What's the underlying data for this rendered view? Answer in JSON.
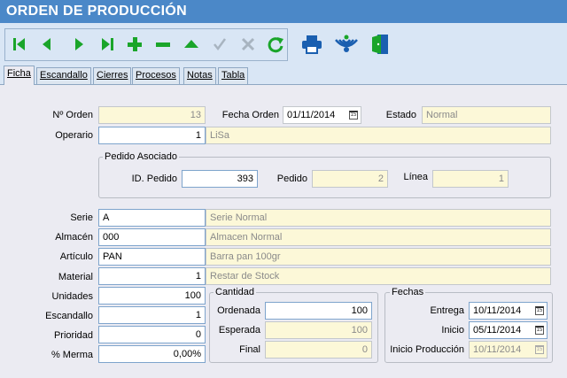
{
  "title": "ORDEN DE PRODUCCIÓN",
  "toolbar": {
    "icons": [
      "first-record-icon",
      "previous-record-icon",
      "next-record-icon",
      "last-record-icon",
      "add-icon",
      "delete-icon",
      "up-icon",
      "accept-icon",
      "cancel-icon",
      "refresh-icon",
      "print-icon",
      "wireless-icon",
      "exit-door-icon"
    ],
    "colors": {
      "green": "#1aa52a",
      "blue": "#1a5fb0",
      "disabled": "#a8b4c0"
    }
  },
  "tabs": [
    "Ficha",
    "Escandallo",
    "Cierres",
    "Procesos",
    "Notas",
    "Tabla"
  ],
  "form": {
    "num_orden_label": "Nº Orden",
    "num_orden": "13",
    "fecha_orden_label": "Fecha Orden",
    "fecha_orden": "01/11/2014",
    "estado_label": "Estado",
    "estado": "Normal",
    "operario_label": "Operario",
    "operario": "1",
    "operario_name": "LiSa"
  },
  "pedido": {
    "group_label": "Pedido Asociado",
    "id_label": "ID. Pedido",
    "id": "393",
    "pedido_label": "Pedido",
    "pedido": "2",
    "linea_label": "Línea",
    "linea": "1"
  },
  "detail": {
    "serie_label": "Serie",
    "serie": "A",
    "serie_desc": "Serie Normal",
    "almacen_label": "Almacén",
    "almacen": "000",
    "almacen_desc": "Almacen Normal",
    "articulo_label": "Artículo",
    "articulo": "PAN",
    "articulo_desc": "Barra pan 100gr",
    "material_label": "Material",
    "material": "1",
    "material_desc": "Restar de Stock",
    "unidades_label": "Unidades",
    "unidades": "100",
    "escandallo_label": "Escandallo",
    "escandallo": "1",
    "prioridad_label": "Prioridad",
    "prioridad": "0",
    "merma_label": "% Merma",
    "merma": "0,00%"
  },
  "cantidad": {
    "group_label": "Cantidad",
    "ordenada_label": "Ordenada",
    "ordenada": "100",
    "esperada_label": "Esperada",
    "esperada": "100",
    "final_label": "Final",
    "final": "0"
  },
  "fechas": {
    "group_label": "Fechas",
    "entrega_label": "Entrega",
    "entrega": "10/11/2014",
    "inicio_label": "Inicio",
    "inicio": "05/11/2014",
    "inicio_prod_label": "Inicio Producción",
    "inicio_prod": "10/11/2014"
  }
}
